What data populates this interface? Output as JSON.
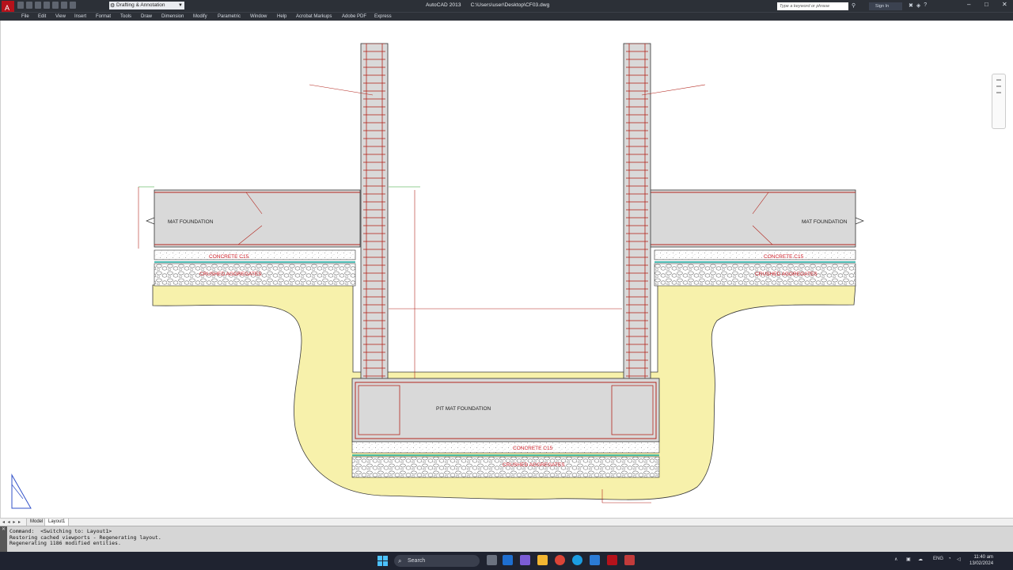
{
  "titlebar": {
    "workspace": "Drafting & Annotation",
    "app_name": "AutoCAD 2013",
    "file_path": "C:\\Users\\user\\Desktop\\CF03.dwg",
    "search_placeholder": "Type a keyword or phrase",
    "signin": "Sign In",
    "help": "?",
    "minimize": "–",
    "maximize": "□",
    "close": "✕"
  },
  "menu": [
    "File",
    "Edit",
    "View",
    "Insert",
    "Format",
    "Tools",
    "Draw",
    "Dimension",
    "Modify",
    "Parametric",
    "Window",
    "Help",
    "Acrobat Markups",
    "Adobe PDF",
    "Express"
  ],
  "drawing": {
    "labels": {
      "mat_left": "MAT FOUNDATION",
      "mat_right": "MAT FOUNDATION",
      "pit_mat": "PIT MAT FOUNDATION",
      "concrete_left": "CONCRETE C15",
      "concrete_right": "CONCRETE C15",
      "concrete_bottom": "CONCRETE C15",
      "crushed_left": "CRUSHED AGGREGATES",
      "crushed_right": "CRUSHED AGGREGATES",
      "crushed_bottom": "CRUSHED AGGREGATES"
    }
  },
  "tabs": {
    "nav": "◂ ◂ ▸ ▸",
    "model": "Model",
    "layout1": "Layout1"
  },
  "command_line": {
    "lines": [
      "Command:  <Switching to: Layout1>",
      "Restoring cached viewports - Regenerating layout.",
      "Regenerating 1186 modified entities."
    ]
  },
  "taskbar": {
    "search": "Search",
    "lang": "ENG",
    "time": "11:40 am",
    "date": "13/02/2024"
  }
}
